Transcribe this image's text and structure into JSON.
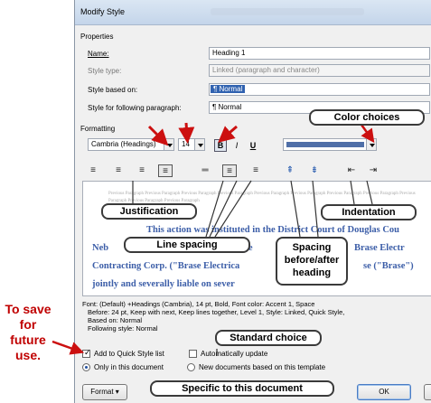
{
  "window": {
    "title": "Modify Style"
  },
  "properties": {
    "heading": "Properties",
    "name_label": "Name:",
    "name_value": "Heading 1",
    "style_type_label": "Style type:",
    "style_type_value": "Linked (paragraph and character)",
    "based_on_label": "Style based on:",
    "based_on_value": "¶ Normal",
    "following_label": "Style for following paragraph:",
    "following_value": "¶ Normal"
  },
  "formatting": {
    "heading": "Formatting",
    "font_value": "Cambria (Headings)",
    "size_value": "14",
    "bold_label": "B",
    "italic_label": "I",
    "underline_label": "U",
    "font_color": "#4f6fa8"
  },
  "preview": {
    "previous_text": "Previous Paragraph Previous Paragraph Previous Paragraph Previous Paragraph Previous Paragraph Previous Paragraph Previous Paragraph Previous Paragraph Previous Paragraph Previous Paragraph Previous Paragraph",
    "line1": "This action was instituted in the District Court of Douglas Cou",
    "line2": "Neb",
    "line2b": "The",
    "line2c": "Brase Electr",
    "line3": "Contracting Corp. (\"Brase Electrica",
    "line3b": "se (\"Brase\")",
    "line4": "jointly and severally liable on sever"
  },
  "description": {
    "line1": "Font: (Default) +Headings (Cambria), 14 pt, Bold, Font color: Accent 1, Space",
    "line2": "Before: 24 pt, Keep with next, Keep lines together, Level 1, Style: Linked, Quick Style,",
    "line3": "Based on: Normal",
    "line4": "Following style: Normal"
  },
  "options": {
    "quick_style_label": "Add to Quick Style list",
    "auto_update_label": "Automatically update",
    "only_doc_label": "Only in this document",
    "new_docs_label": "New documents based on this template"
  },
  "buttons": {
    "format_label": "Format ▾",
    "ok_label": "OK"
  },
  "callouts": {
    "color_choices": "Color choices",
    "justification": "Justification",
    "indentation": "Indentation",
    "line_spacing": "Line spacing",
    "spacing": "Spacing before/after heading",
    "standard_choice": "Standard choice",
    "specific": "Specific to this document",
    "side_note": "To save for future use."
  },
  "colors": {
    "arrow_red": "#cc1010",
    "side_text": "#c00000",
    "title_bar": "#c4d5ea"
  }
}
